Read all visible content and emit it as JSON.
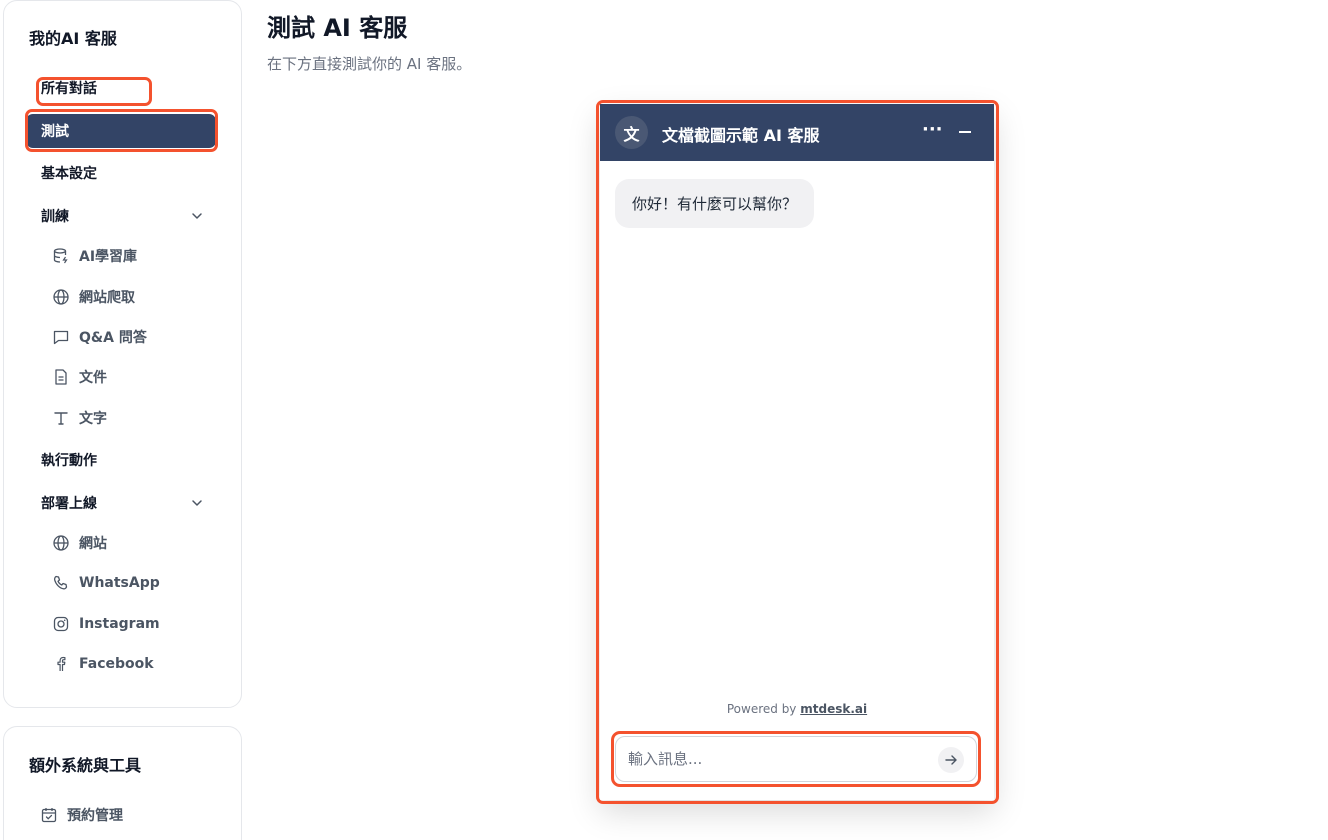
{
  "sidebar": {
    "title": "我的AI 客服",
    "items": {
      "all_conversations": "所有對話",
      "test": "測試",
      "basic_settings": "基本設定",
      "training": "訓練",
      "actions": "執行動作",
      "deploy": "部署上線"
    },
    "training_sub": {
      "ai_library": "AI學習庫",
      "web_crawl": "網站爬取",
      "qa": "Q&A 問答",
      "documents": "文件",
      "text": "文字"
    },
    "deploy_sub": {
      "website": "網站",
      "whatsapp": "WhatsApp",
      "instagram": "Instagram",
      "facebook": "Facebook"
    }
  },
  "extra": {
    "title": "額外系統與工具",
    "booking": "預約管理"
  },
  "main": {
    "title": "測試 AI 客服",
    "subtitle": "在下方直接測試你的 AI 客服。"
  },
  "widget": {
    "avatar_letter": "文",
    "title": "文檔截圖示範 AI 客服",
    "more": "···",
    "greeting": "你好！有什麼可以幫你？",
    "powered_prefix": "Powered by",
    "powered_brand": "mtdesk.ai",
    "input_placeholder": "輸入訊息..."
  },
  "colors": {
    "accent": "#334466",
    "highlight": "#f4522e"
  }
}
